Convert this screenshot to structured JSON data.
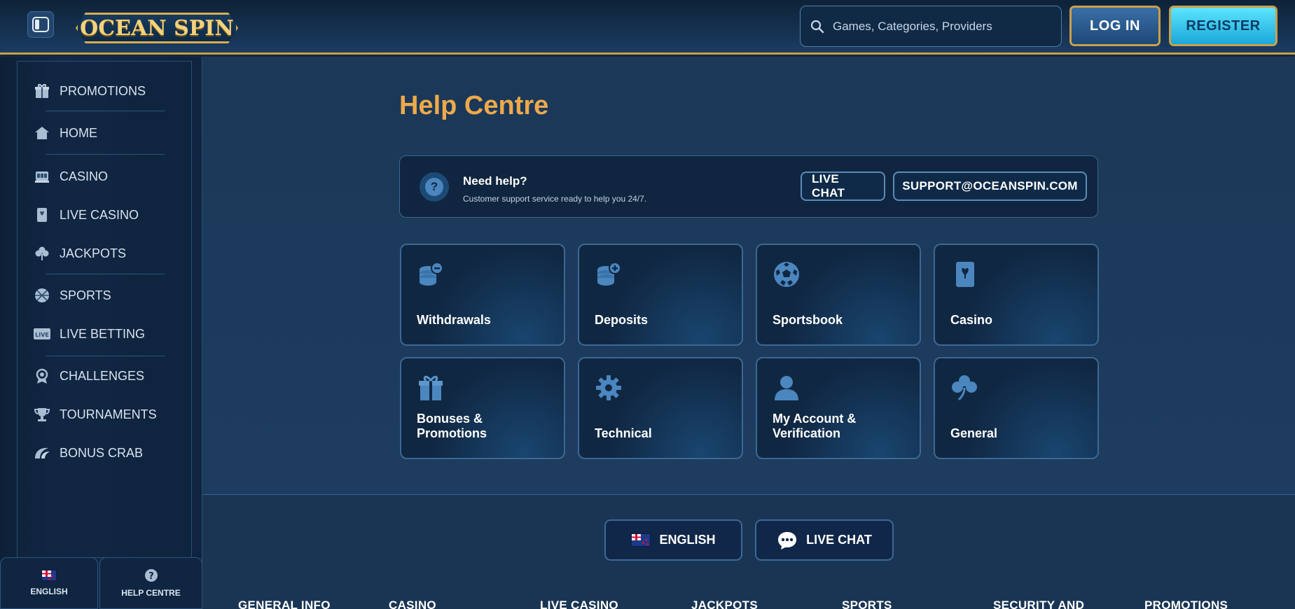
{
  "header": {
    "logo_text": "OCEAN SPIN",
    "search_placeholder": "Games, Categories, Providers",
    "login_label": "LOG IN",
    "register_label": "REGISTER"
  },
  "sidebar": {
    "items": [
      {
        "label": "PROMOTIONS",
        "icon": "gift-icon"
      },
      {
        "label": "HOME",
        "icon": "home-icon"
      },
      {
        "label": "CASINO",
        "icon": "slot-machine-icon"
      },
      {
        "label": "LIVE CASINO",
        "icon": "card-icon"
      },
      {
        "label": "JACKPOTS",
        "icon": "clover-icon"
      },
      {
        "label": "SPORTS",
        "icon": "ball-icon"
      },
      {
        "label": "LIVE BETTING",
        "icon": "live-icon"
      },
      {
        "label": "CHALLENGES",
        "icon": "badge-icon"
      },
      {
        "label": "TOURNAMENTS",
        "icon": "trophy-icon"
      },
      {
        "label": "BONUS CRAB",
        "icon": "crab-icon"
      }
    ],
    "bottom": {
      "language_label": "ENGLISH",
      "help_label": "HELP CENTRE"
    }
  },
  "main": {
    "title": "Help Centre",
    "help_banner": {
      "title": "Need help?",
      "subtitle": "Customer support service ready to help you 24/7.",
      "live_chat_label": "LIVE CHAT",
      "email_label": "SUPPORT@OCEANSPIN.COM"
    },
    "categories": [
      {
        "label": "Withdrawals",
        "icon": "coins-minus-icon"
      },
      {
        "label": "Deposits",
        "icon": "coins-plus-icon"
      },
      {
        "label": "Sportsbook",
        "icon": "soccer-ball-icon"
      },
      {
        "label": "Casino",
        "icon": "playing-card-icon"
      },
      {
        "label": "Bonuses & Promotions",
        "icon": "gift-icon"
      },
      {
        "label": "Technical",
        "icon": "gear-icon"
      },
      {
        "label": "My Account & Verification",
        "icon": "user-icon"
      },
      {
        "label": "General",
        "icon": "clover-icon"
      }
    ]
  },
  "footer": {
    "language_label": "ENGLISH",
    "live_chat_label": "LIVE CHAT",
    "columns": [
      "GENERAL INFO",
      "CASINO",
      "LIVE CASINO",
      "JACKPOTS",
      "SPORTS",
      "SECURITY AND",
      "PROMOTIONS"
    ]
  },
  "colors": {
    "accent_gold": "#c9a04a",
    "title_orange": "#eda94a",
    "icon_blue": "#4b86be"
  }
}
